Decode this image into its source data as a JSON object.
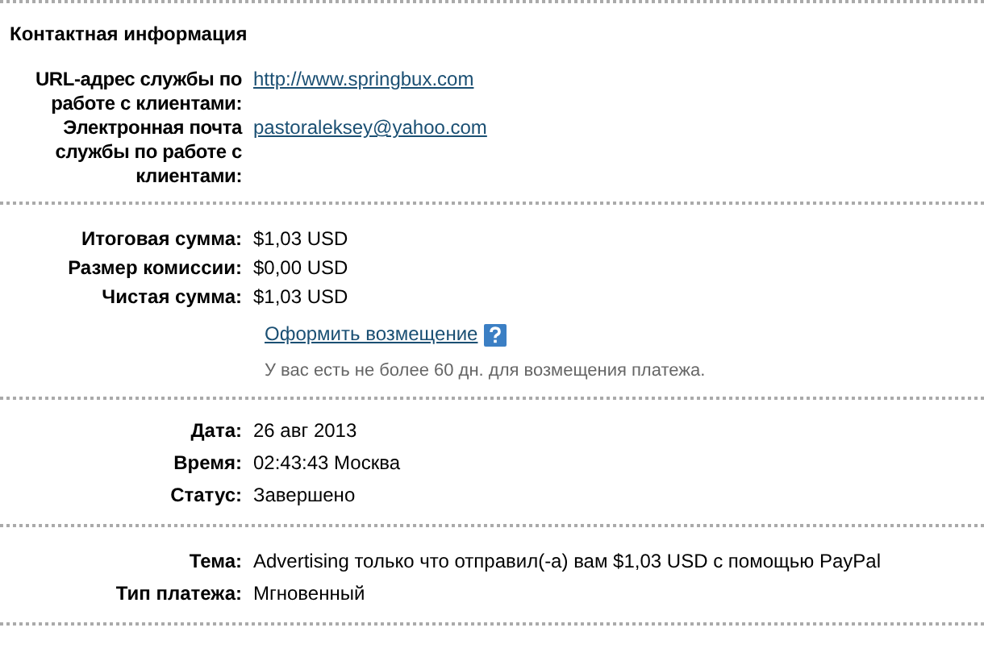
{
  "heading": "Контактная информация",
  "contact": [
    {
      "label": "URL-адрес службы по работе с клиентами:",
      "value": "http://www.springbux.com",
      "kind": "link"
    },
    {
      "label": "Электронная почта службы по работе с клиентами:",
      "value": "pastoraleksey@yahoo.com",
      "kind": "link"
    }
  ],
  "amounts": [
    {
      "label": "Итоговая сумма:",
      "value": "$1,03 USD",
      "kind": "text"
    },
    {
      "label": "Размер комиссии:",
      "value": "$0,00 USD",
      "kind": "text"
    },
    {
      "label": "Чистая сумма:",
      "value": "$1,03 USD",
      "kind": "text"
    }
  ],
  "refund": {
    "link": "Оформить возмещение",
    "note": "У вас есть не более 60 дн. для возмещения платежа."
  },
  "details": [
    {
      "label": "Дата:",
      "value": "26 авг 2013",
      "kind": "text"
    },
    {
      "label": "Время:",
      "value": "02:43:43 Москва",
      "kind": "text"
    },
    {
      "label": "Статус:",
      "value": "Завершено",
      "kind": "text"
    }
  ],
  "payment": [
    {
      "label": "Тема:",
      "value": "Advertising только что отправил(-а) вам $1,03 USD с помощью PayPal",
      "kind": "text"
    },
    {
      "label": "Тип платежа:",
      "value": "Мгновенный",
      "kind": "text"
    }
  ]
}
